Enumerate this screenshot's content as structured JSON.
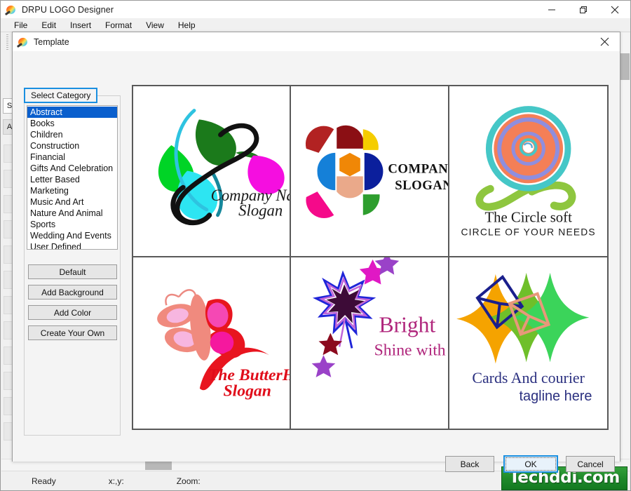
{
  "app": {
    "title": "DRPU LOGO Designer",
    "icon": "palette-icon",
    "window_controls": {
      "minimize": "minimize-icon",
      "maximize": "maximize-icon",
      "close": "close-icon"
    },
    "menu": [
      "File",
      "Edit",
      "Insert",
      "Format",
      "View",
      "Help"
    ]
  },
  "dialog": {
    "title": "Template",
    "icon": "palette-icon",
    "close": "close-icon",
    "category": {
      "legend": "Select Category",
      "items": [
        "Abstract",
        "Books",
        "Children",
        "Construction",
        "Financial",
        "Gifts And Celebration",
        "Letter Based",
        "Marketing",
        "Music And Art",
        "Nature And Animal",
        "Sports",
        "Wedding And Events",
        "User Defined"
      ],
      "selected": "Abstract"
    },
    "side_buttons": [
      "Default",
      "Add Background",
      "Add Color",
      "Create Your Own"
    ],
    "templates": [
      {
        "id": "company-name-slogan",
        "name": "Company Name",
        "tagline": "Slogan"
      },
      {
        "id": "company-name-slogan-here",
        "name": "COMPANY NAME",
        "tagline": "SLOGAN HERE"
      },
      {
        "id": "the-circle-soft",
        "name": "The Circle soft",
        "tagline": "CIRCLE OF YOUR NEEDS"
      },
      {
        "id": "the-butterhalf",
        "name": "The ButterHalf",
        "tagline": "Slogan"
      },
      {
        "id": "bright",
        "name": "Bright",
        "tagline": "Shine with us"
      },
      {
        "id": "cards-and-courier",
        "name": "Cards And courier",
        "tagline": "tagline here"
      }
    ],
    "buttons": {
      "back": "Back",
      "ok": "OK",
      "cancel": "Cancel"
    }
  },
  "statusbar": {
    "ready": "Ready",
    "coords": "x:,y:",
    "zoom": "Zoom:"
  },
  "watermark": {
    "text": "Techddi.com"
  },
  "colors": {
    "accent_blue": "#1a8fe0",
    "selection_blue": "#0a5fcd",
    "watermark_green": "#1f8a2b",
    "grid_border": "#595959"
  }
}
